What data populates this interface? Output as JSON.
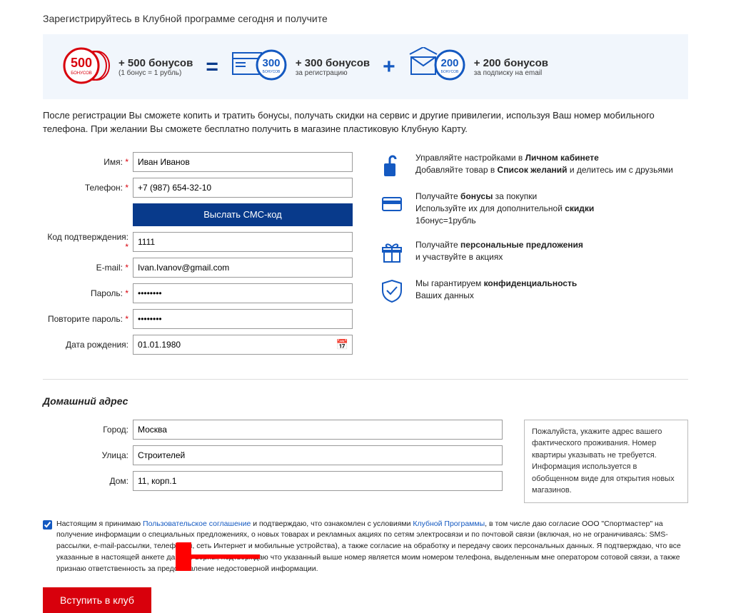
{
  "heading": "Зарегистрируйтесь в Клубной программе сегодня и получите",
  "bonus_banner": {
    "block1": {
      "big": "+ 500 бонусов",
      "small": "(1 бонус = 1 рубль)"
    },
    "block2": {
      "big": "+ 300 бонусов",
      "small": "за регистрацию"
    },
    "block3": {
      "big": "+ 200 бонусов",
      "small": "за подписку на email"
    }
  },
  "description": "После регистрации Вы сможете копить и тратить бонусы, получать скидки на сервис и другие привилегии, используя Ваш номер мобильного телефона. При желании Вы сможете бесплатно получить в магазине пластиковую Клубную Карту.",
  "form": {
    "name_label": "Имя:",
    "name_value": "Иван Иванов",
    "phone_label": "Телефон:",
    "phone_value": "+7 (987) 654-32-10",
    "sms_button": "Выслать СМС-код",
    "code_label": "Код подтверждения:",
    "code_value": "1111",
    "email_label": "E-mail:",
    "email_value": "Ivan.Ivanov@gmail.com",
    "password_label": "Пароль:",
    "password_value": "••••••••",
    "password2_label": "Повторите пароль:",
    "password2_value": "••••••••",
    "dob_label": "Дата рождения:",
    "dob_value": "01.01.1980"
  },
  "benefits": [
    {
      "html": "Управляйте настройками в <b>Личном кабинете</b><br>Добавляйте товар в <b>Список желаний</b> и делитесь им с друзьями"
    },
    {
      "html": "Получайте <b>бонусы</b> за покупки<br>Используйте их для дополнительной <b>скидки</b><br>1бонус=1рубль"
    },
    {
      "html": "Получайте <b>персональные предложения</b><br>и участвуйте в акциях"
    },
    {
      "html": "Мы гарантируем <b>конфиденциальность</b><br>Ваших данных"
    }
  ],
  "address": {
    "section_title": "Домашний адрес",
    "city_label": "Город:",
    "city_value": "Москва",
    "street_label": "Улица:",
    "street_value": "Строителей",
    "house_label": "Дом:",
    "house_value": "11, корп.1",
    "hint": "Пожалуйста, укажите адрес вашего фактического проживания. Номер квартиры указывать не требуется. Информация используется в обобщенном виде для открытия новых магазинов."
  },
  "agreement": {
    "prefix": "Настоящим я принимаю ",
    "link1": "Пользовательское соглашение",
    "mid1": " и подтверждаю, что ознакомлен с условиями ",
    "link2": "Клубной Программы",
    "rest": ", в том числе даю согласие ООО \"Спортмастер\" на получение информации о специальных предложениях, о новых товарах и рекламных акциях по сетям электросвязи и по почтовой связи (включая, но не ограничиваясь: SMS-рассылки, e-mail-рассылки, телефония, сеть Интернет и мобильные устройства), а также согласие на обработку и передачу своих персональных данных. Я подтверждаю, что все указанные в настоящей анкете данные верны, подтверждаю что указанный выше номер является моим номером телефона, выделенным мне оператором сотовой связи, а также признаю ответственность за предоставление недостоверной информации."
  },
  "submit_label": "Вступить в клуб"
}
